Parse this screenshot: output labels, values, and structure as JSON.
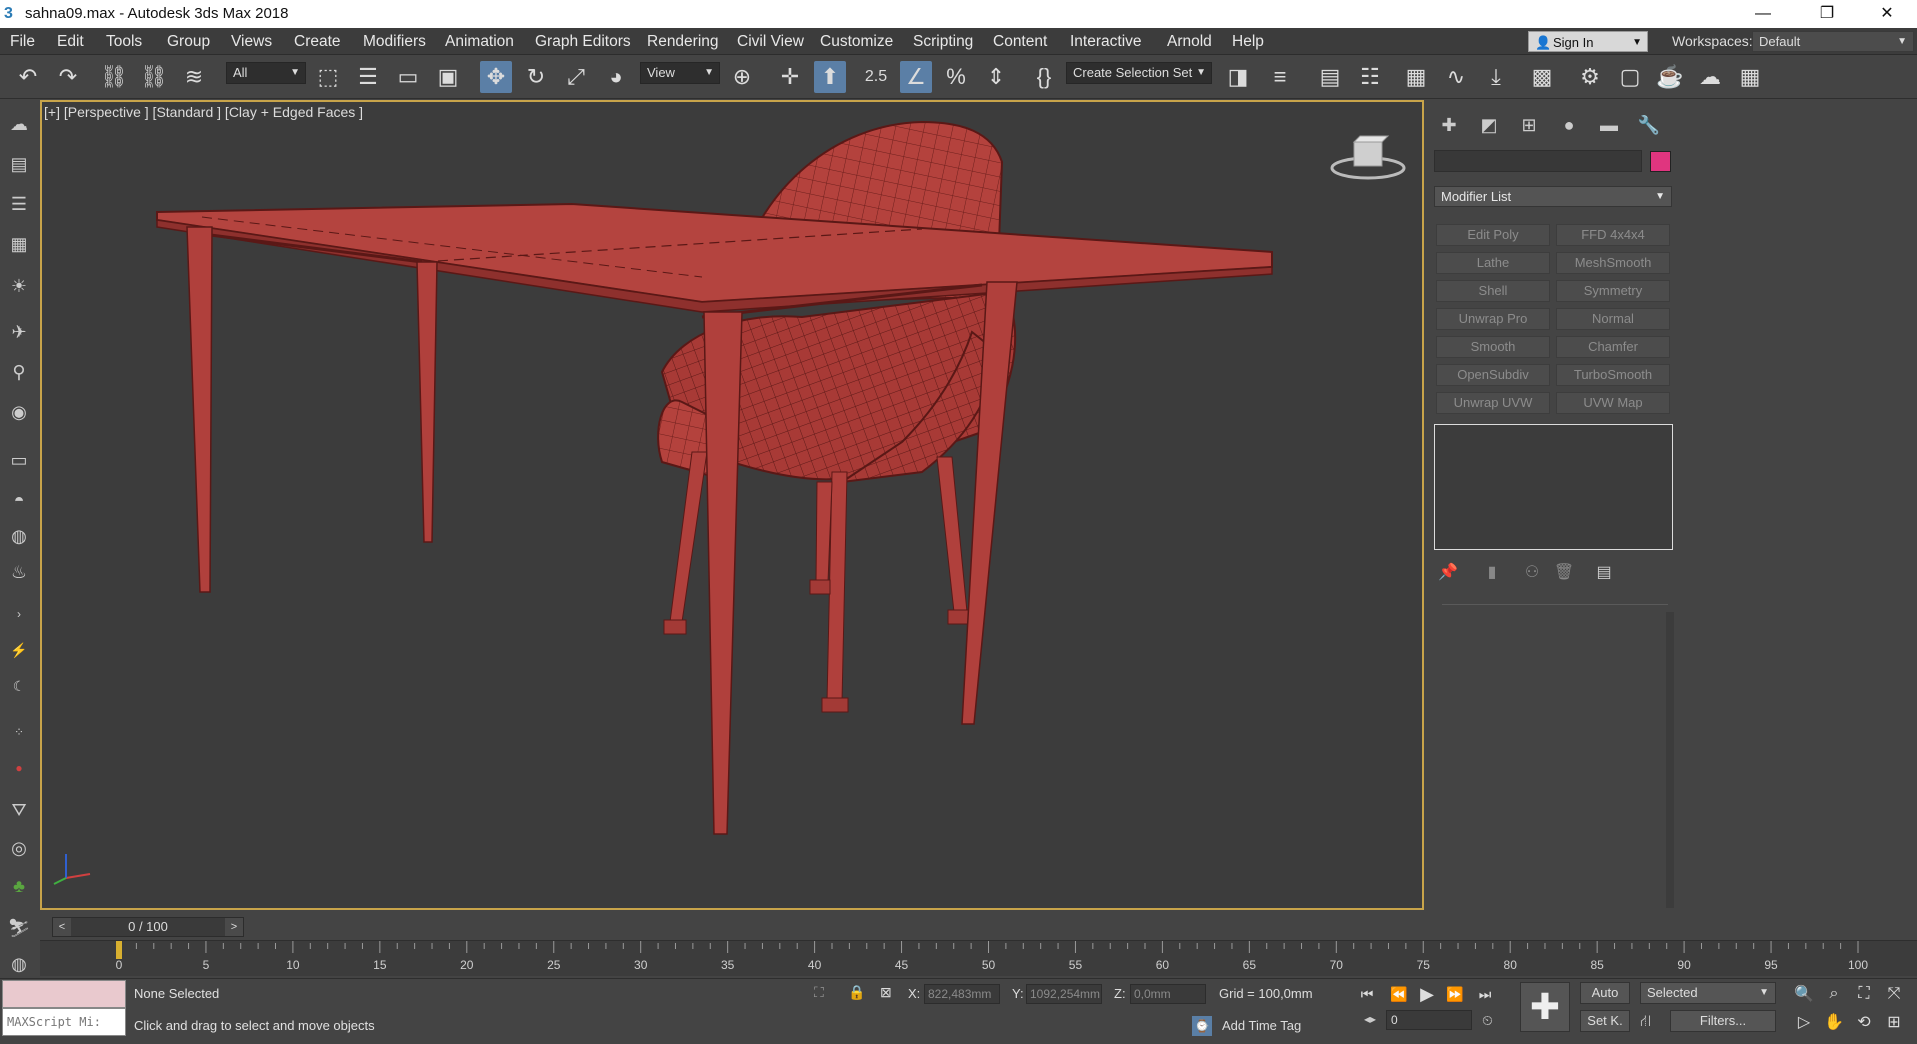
{
  "window": {
    "title": "sahna09.max - Autodesk 3ds Max 2018",
    "app_icon": "3",
    "minimize": "—",
    "restore": "❐",
    "close": "✕"
  },
  "menu": [
    "File",
    "Edit",
    "Tools",
    "Group",
    "Views",
    "Create",
    "Modifiers",
    "Animation",
    "Graph Editors",
    "Rendering",
    "Civil View",
    "Customize",
    "Scripting",
    "Content",
    "Interactive",
    "Arnold",
    "Help"
  ],
  "signin": {
    "label": "Sign In"
  },
  "workspaces": {
    "label": "Workspaces:",
    "value": "Default"
  },
  "toolbar": {
    "filter": "All",
    "ref_coord": "View",
    "selection_set": "Create Selection Set",
    "snap_label": "2.5"
  },
  "viewport": {
    "label": "[+] [Perspective ] [Standard ] [Clay + Edged Faces ]",
    "model_color": "#b0403c"
  },
  "command_panel": {
    "object_color": "#e0357f",
    "modifier_list": "Modifier List",
    "modifier_buttons": [
      "Edit Poly",
      "FFD 4x4x4",
      "Lathe",
      "MeshSmooth",
      "Shell",
      "Symmetry",
      "Unwrap Pro",
      "Normal",
      "Smooth",
      "Chamfer",
      "OpenSubdiv",
      "TurboSmooth",
      "Unwrap UVW",
      "UVW Map"
    ]
  },
  "timeline": {
    "slider": "0 / 100",
    "ticks": [
      "0",
      "5",
      "10",
      "15",
      "20",
      "25",
      "30",
      "35",
      "40",
      "45",
      "50",
      "55",
      "60",
      "65",
      "70",
      "75",
      "80",
      "85",
      "90",
      "95",
      "100"
    ]
  },
  "status": {
    "maxscript": "MAXScript Mi:",
    "selection": "None Selected",
    "prompt": "Click and drag to select and move objects",
    "x_label": "X:",
    "x_value": "822,483mm",
    "y_label": "Y:",
    "y_value": "1092,254mm",
    "z_label": "Z:",
    "z_value": "0,0mm",
    "grid": "Grid = 100,0mm",
    "add_time_tag": "Add Time Tag",
    "frame": "0",
    "auto_key": "Auto",
    "set_key": "Set K.",
    "key_filter": "Selected",
    "filters": "Filters..."
  }
}
